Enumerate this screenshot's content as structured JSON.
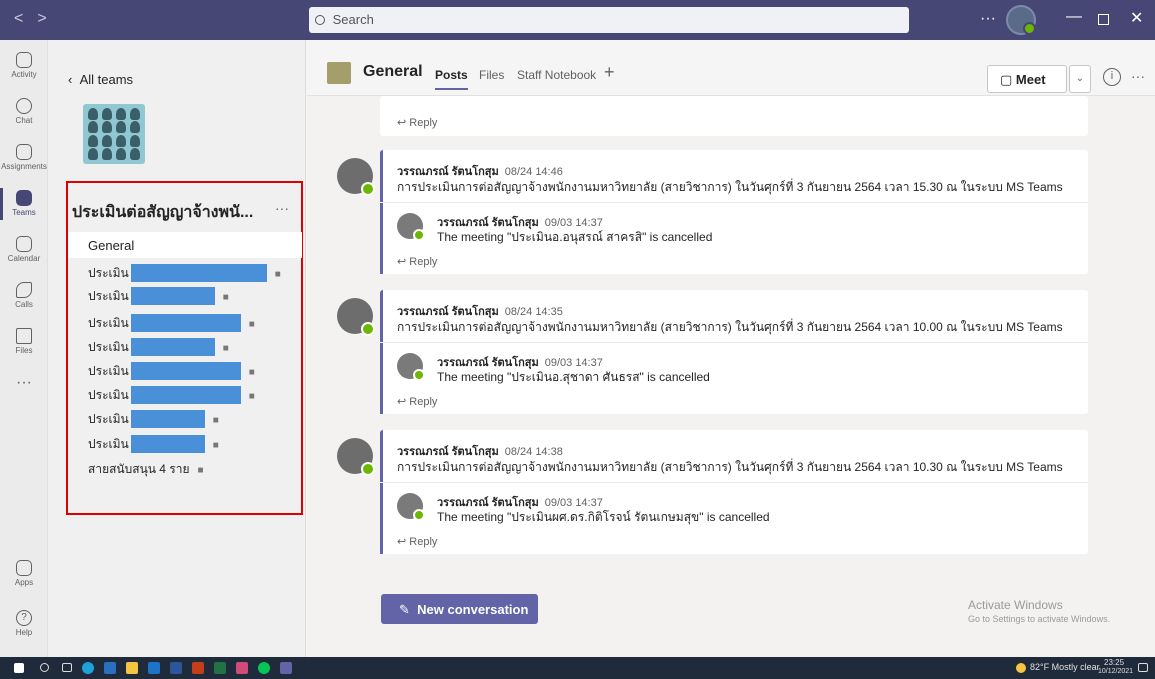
{
  "titlebar": {
    "search_placeholder": "Search",
    "more": "···",
    "nav_back": "<",
    "nav_fwd": ">"
  },
  "rail": [
    {
      "label": "Activity",
      "icon": "bell-icon"
    },
    {
      "label": "Chat",
      "icon": "chat-icon"
    },
    {
      "label": "Assignments",
      "icon": "assignments-icon"
    },
    {
      "label": "Teams",
      "icon": "teams-icon",
      "active": true
    },
    {
      "label": "Calendar",
      "icon": "calendar-icon"
    },
    {
      "label": "Calls",
      "icon": "phone-icon"
    },
    {
      "label": "Files",
      "icon": "file-icon"
    },
    {
      "label": "Apps",
      "icon": "apps-icon"
    },
    {
      "label": "Help",
      "icon": "help-icon"
    }
  ],
  "panel": {
    "back_label": "All teams",
    "team_name": "ประเมินต่อสัญญาจ้างพนั...",
    "more": "···",
    "general": "General",
    "channels": [
      "ประเมิน",
      "ประเมิน",
      "ประเมิน",
      "ประเมิน",
      "ประเมิน",
      "ประเมิน",
      "ประเมิน",
      "ประเมิน",
      "สายสนับสนุน 4 ราย"
    ]
  },
  "header": {
    "channel_title": "General",
    "tabs": [
      "Posts",
      "Files",
      "Staff Notebook"
    ],
    "add_tab": "+",
    "meet": "Meet",
    "info": "i",
    "more": "···"
  },
  "messages": {
    "reply_label": "Reply",
    "threads": [
      {
        "author": "วรรณภรณ์ รัตนโกสุม",
        "time": "08/24 14:46",
        "text": "การประเมินการต่อสัญญาจ้างพนักงานมหาวิทยาลัย (สายวิชาการ) ในวันศุกร์ที่ 3 กันยายน 2564 เวลา 15.30 ณ ในระบบ MS Teams",
        "reply_author": "วรรณภรณ์ รัตนโกสุม",
        "reply_time": "09/03 14:37",
        "reply_text": "The meeting \"ประเมินอ.อนุสรณ์ สาครสิ\" is cancelled"
      },
      {
        "author": "วรรณภรณ์ รัตนโกสุม",
        "time": "08/24 14:35",
        "text": "การประเมินการต่อสัญญาจ้างพนักงานมหาวิทยาลัย (สายวิชาการ) ในวันศุกร์ที่ 3 กันยายน 2564 เวลา 10.00 ณ ในระบบ MS Teams",
        "reply_author": "วรรณภรณ์ รัตนโกสุม",
        "reply_time": "09/03 14:37",
        "reply_text": "The meeting \"ประเมินอ.สุชาดา ศันธรส\" is cancelled"
      },
      {
        "author": "วรรณภรณ์ รัตนโกสุม",
        "time": "08/24 14:38",
        "text": "การประเมินการต่อสัญญาจ้างพนักงานมหาวิทยาลัย (สายวิชาการ) ในวันศุกร์ที่ 3 กันยายน 2564 เวลา 10.30 ณ ในระบบ MS Teams",
        "reply_author": "วรรณภรณ์ รัตนโกสุม",
        "reply_time": "09/03 14:37",
        "reply_text": "The meeting \"ประเมินผศ.ดร.กิติโรจน์ รัตนเกษมสุข\" is cancelled"
      }
    ]
  },
  "new_conversation": "New conversation",
  "activate": {
    "title": "Activate Windows",
    "sub": "Go to Settings to activate Windows."
  },
  "taskbar": {
    "weather": "82°F Mostly clear",
    "time": "23:25",
    "date": "10/12/2021"
  }
}
